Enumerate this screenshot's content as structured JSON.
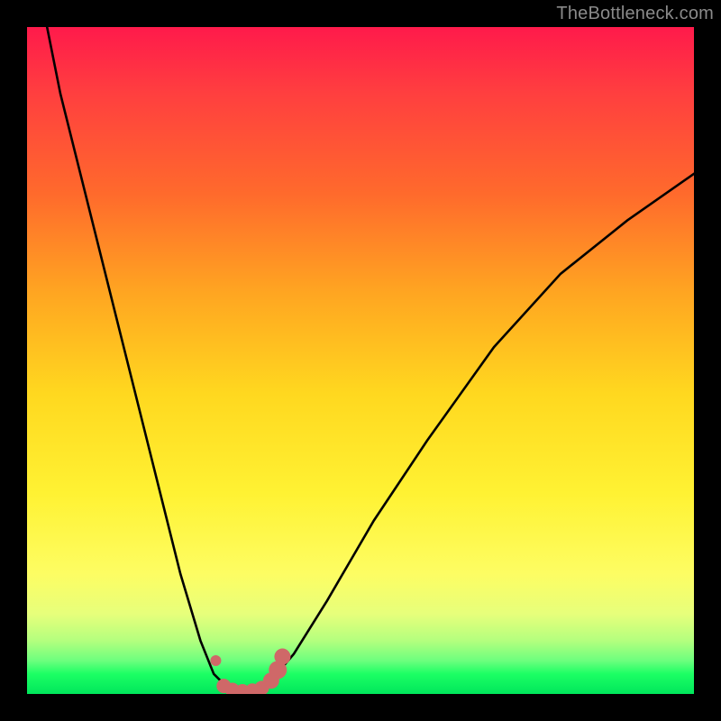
{
  "watermark": "TheBottleneck.com",
  "chart_data": {
    "type": "line",
    "title": "",
    "xlabel": "",
    "ylabel": "",
    "xlim": [
      0,
      100
    ],
    "ylim": [
      0,
      100
    ],
    "series": [
      {
        "name": "bottleneck-curve",
        "x": [
          3,
          5,
          8,
          12,
          16,
          20,
          23,
          26,
          28,
          30,
          31,
          32,
          33,
          34,
          35,
          37,
          40,
          45,
          52,
          60,
          70,
          80,
          90,
          100
        ],
        "y": [
          100,
          90,
          78,
          62,
          46,
          30,
          18,
          8,
          3,
          1,
          0.5,
          0.3,
          0.3,
          0.5,
          1,
          2.5,
          6,
          14,
          26,
          38,
          52,
          63,
          71,
          78
        ]
      }
    ],
    "markers": {
      "name": "highlight-points",
      "color": "#cf6868",
      "points": [
        {
          "x": 28.3,
          "y": 5.0,
          "r": 6
        },
        {
          "x": 29.5,
          "y": 1.2,
          "r": 8
        },
        {
          "x": 30.8,
          "y": 0.6,
          "r": 8
        },
        {
          "x": 32.3,
          "y": 0.4,
          "r": 8
        },
        {
          "x": 33.8,
          "y": 0.5,
          "r": 8
        },
        {
          "x": 35.2,
          "y": 0.9,
          "r": 8
        },
        {
          "x": 36.6,
          "y": 2.0,
          "r": 9
        },
        {
          "x": 37.6,
          "y": 3.6,
          "r": 10
        },
        {
          "x": 38.3,
          "y": 5.6,
          "r": 9
        }
      ]
    },
    "colors": {
      "curve": "#000000",
      "marker": "#cf6868",
      "gradient_top": "#ff1a4b",
      "gradient_bottom": "#00e65b"
    }
  }
}
